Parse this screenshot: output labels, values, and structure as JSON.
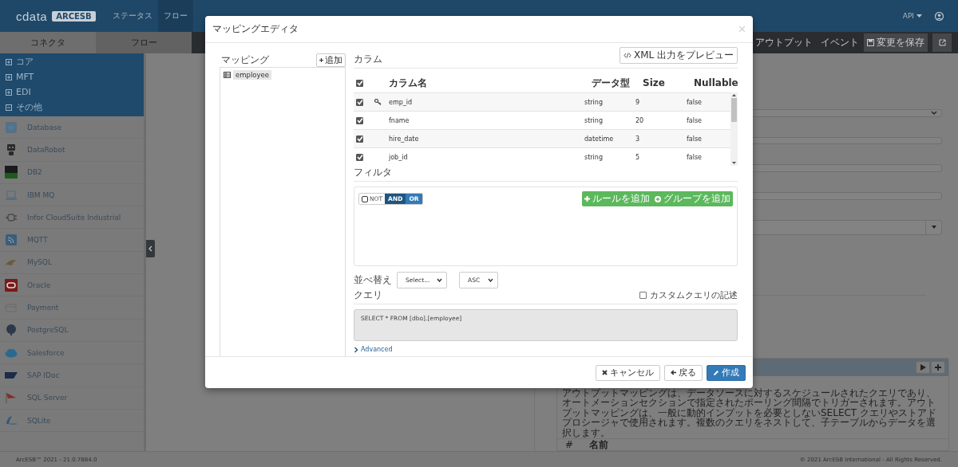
{
  "header": {
    "logo_mark": "cdata",
    "logo_badge": "ARCESB",
    "nav": [
      {
        "label": "ステータス",
        "selected": false
      },
      {
        "label": "フロー",
        "selected": true
      }
    ],
    "api_menu": "API"
  },
  "subheader": {
    "tabs": [
      {
        "label": "コネクタ",
        "selected": true
      },
      {
        "label": "フロー",
        "selected": false
      }
    ],
    "right_tabs": [
      "アウトプット",
      "イベント"
    ],
    "save_button": "変更を保存"
  },
  "sidebar": {
    "groups": [
      {
        "label": "コア",
        "expanded": false
      },
      {
        "label": "MFT",
        "expanded": false
      },
      {
        "label": "EDI",
        "expanded": false
      },
      {
        "label": "その他",
        "expanded": true
      }
    ],
    "items": [
      "Database",
      "DataRobot",
      "DB2",
      "IBM MQ",
      "Infor CloudSuite Industrial",
      "MQTT",
      "MySQL",
      "Oracle",
      "Payment",
      "PostgreSQL",
      "Salesforce",
      "SAP IDoc",
      "SQL Server",
      "SQLite"
    ]
  },
  "form": {
    "fields": [
      {
        "kind": "select"
      },
      {
        "kind": "input"
      },
      {
        "kind": "input"
      },
      {
        "kind": "input"
      },
      {
        "kind": "combo"
      }
    ]
  },
  "panel": {
    "description": "アウトプットマッピングは、データソースに対するスケジュールされたクエリであり、オートメーションセクションで指定されたポーリング間隔でトリガーされます。アウトプットマッピングは、一般に動的インプットを必要としないSELECT クエリやストアドプロシージャで使用されます。複数のクエリをネストして、子テーブルからデータを選択します。",
    "columns": [
      "#",
      "名前"
    ]
  },
  "footer": {
    "version": "ArcESB™ 2021 - 21.0.7884.0",
    "copyright": "© 2021 ArcESB International - All Rights Reserved."
  },
  "modal": {
    "title": "マッピングエディタ",
    "mapping_label": "マッピング",
    "add_button": "追加",
    "tree": [
      {
        "label": "employee",
        "selected": true
      }
    ],
    "columns_label": "カラム",
    "preview_button": "XML 出力をプレビュー",
    "table": {
      "select_all": true,
      "headers": [
        "カラム名",
        "データ型",
        "Size",
        "Nullable"
      ],
      "rows": [
        {
          "checked": true,
          "key": true,
          "name": "emp_id",
          "type": "string",
          "size": "9",
          "nullable": "false"
        },
        {
          "checked": true,
          "key": false,
          "name": "fname",
          "type": "string",
          "size": "20",
          "nullable": "false"
        },
        {
          "checked": true,
          "key": false,
          "name": "hire_date",
          "type": "datetime",
          "size": "3",
          "nullable": "false"
        },
        {
          "checked": true,
          "key": false,
          "name": "job_id",
          "type": "string",
          "size": "5",
          "nullable": "false"
        }
      ]
    },
    "filter_label": "フィルタ",
    "not_toggle": {
      "label": "NOT",
      "checked": false
    },
    "conjunctions": [
      {
        "label": "AND",
        "selected": true
      },
      {
        "label": "OR",
        "selected": false
      }
    ],
    "filter_actions": [
      {
        "label": "ルールを追加",
        "kind": "rule"
      },
      {
        "label": "グループを追加",
        "kind": "group"
      }
    ],
    "sort": {
      "label": "並べ替え",
      "field": "Select...",
      "order": "ASC"
    },
    "query": {
      "label": "クエリ",
      "custom_label": "カスタムクエリの記述",
      "custom_checked": false,
      "text": "SELECT * FROM [dbo].[employee]"
    },
    "advanced": {
      "label": "Advanced",
      "expanded": false
    },
    "buttons": [
      {
        "label": "キャンセル",
        "kind": "cancel"
      },
      {
        "label": "戻る",
        "kind": "back"
      },
      {
        "label": "作成",
        "kind": "primary"
      }
    ]
  }
}
